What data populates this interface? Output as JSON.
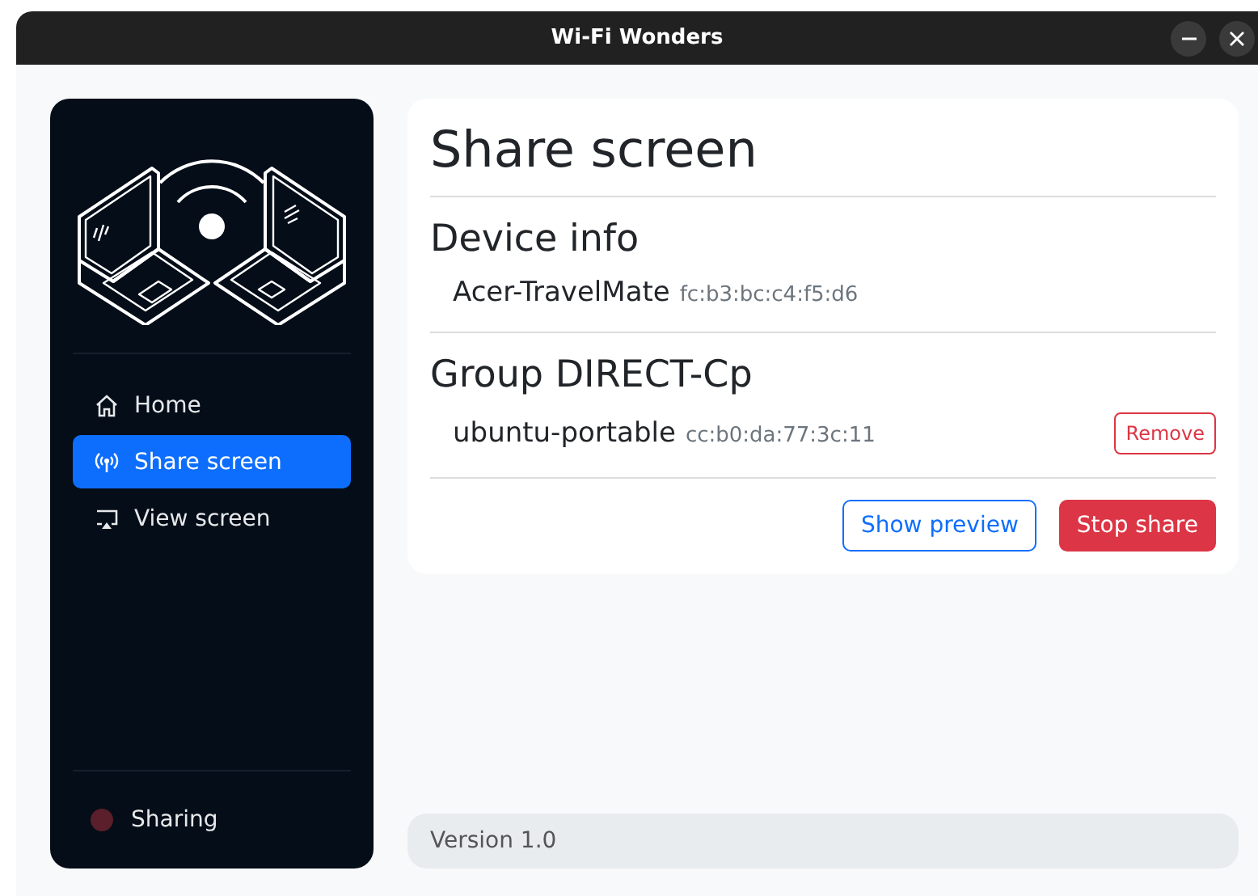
{
  "window": {
    "title": "Wi-Fi Wonders"
  },
  "sidebar": {
    "items": [
      {
        "label": "Home",
        "kind": "home",
        "selected": false
      },
      {
        "label": "Share screen",
        "kind": "broadcast",
        "selected": true
      },
      {
        "label": "View screen",
        "kind": "display",
        "selected": false
      }
    ],
    "status": {
      "label": "Sharing",
      "on": false
    }
  },
  "page": {
    "title": "Share screen",
    "sections": [
      {
        "title": "Device info",
        "devices": [
          {
            "name": "Acer-TravelMate",
            "mac": "fc:b3:bc:c4:f5:d6"
          }
        ]
      },
      {
        "title": "Group DIRECT-Cp",
        "devices": [
          {
            "name": "ubuntu-portable",
            "mac": "cc:b0:da:77:3c:11",
            "action": "Remove"
          }
        ]
      }
    ],
    "buttons": [
      {
        "label": "Show preview",
        "kind": "outline"
      },
      {
        "label": "Stop share",
        "kind": "danger"
      }
    ]
  },
  "footer": {
    "version": "Version 1.0"
  }
}
